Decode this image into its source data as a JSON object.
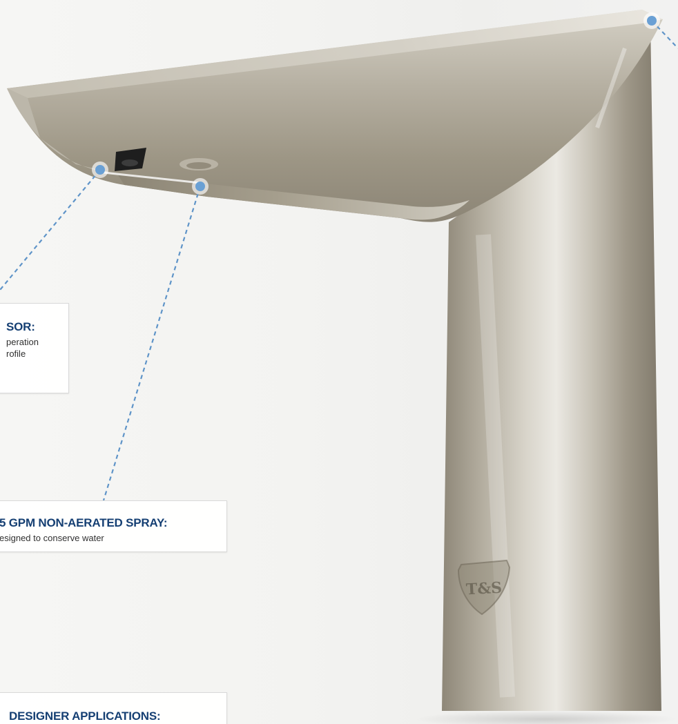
{
  "callouts": [
    {
      "title": "SOR:",
      "lines": [
        "peration",
        "rofile"
      ]
    },
    {
      "title": "5 GPM NON-AERATED SPRAY:",
      "lines": [
        "esigned to conserve water"
      ]
    },
    {
      "title": "DESIGNER APPLICATIONS:",
      "lines": []
    }
  ],
  "logo": {
    "text": "T&S"
  },
  "colors": {
    "callout_title": "#153f73",
    "accent_dot": "#6aa0d4",
    "faucet_finish": "#9e9684"
  }
}
